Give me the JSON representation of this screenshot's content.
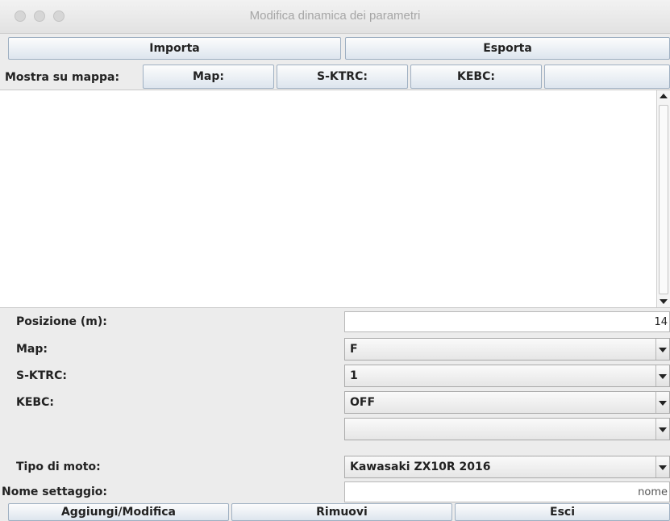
{
  "window": {
    "title": "Modifica dinamica dei parametri"
  },
  "toolbar": {
    "import_label": "Importa",
    "export_label": "Esporta"
  },
  "map_row": {
    "label": "Mostra su mappa:",
    "buttons": [
      "Map:",
      "S-KTRC:",
      "KEBC:",
      ""
    ]
  },
  "form": {
    "position_label": "Posizione (m):",
    "position_value": "14",
    "map_label": "Map:",
    "map_value": "F",
    "sktrc_label": "S-KTRC:",
    "sktrc_value": "1",
    "kebc_label": "KEBC:",
    "kebc_value": "OFF",
    "extra_label": "",
    "extra_value": "",
    "bike_label": "Tipo di moto:",
    "bike_value": "Kawasaki ZX10R 2016",
    "setting_label": "Nome settaggio:",
    "setting_placeholder": "nome"
  },
  "actions": {
    "add_label": "Aggiungi/Modifica",
    "remove_label": "Rimuovi",
    "exit_label": "Esci"
  }
}
